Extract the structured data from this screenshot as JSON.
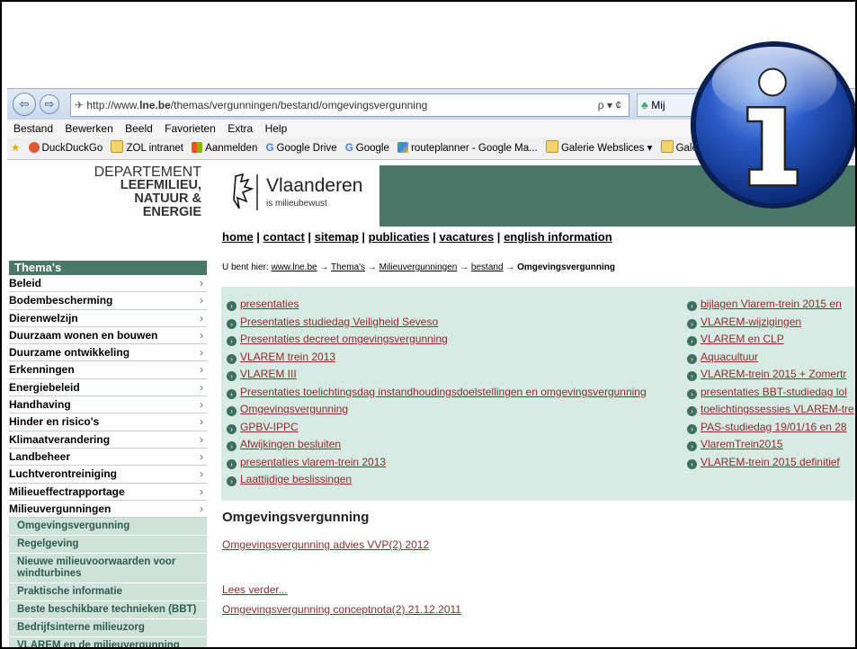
{
  "browser": {
    "url_prefix": "http://www.",
    "url_bold": "lne.be",
    "url_rest": "/themas/vergunningen/bestand/omgevingsvergunning",
    "search_glyph": "ρ ▾ ¢",
    "tab_label": "Mij"
  },
  "menu": [
    "Bestand",
    "Bewerken",
    "Beeld",
    "Favorieten",
    "Extra",
    "Help"
  ],
  "favorites": [
    "DuckDuckGo",
    "ZOL intranet",
    "Aanmelden",
    "Google Drive",
    "Google",
    "routeplanner - Google Ma...",
    "Galerie Webslices ▾",
    "Galerie We"
  ],
  "header": {
    "dept_line1": "DEPARTEMENT",
    "dept_line2": "LEEFMILIEU,",
    "dept_line3": "NATUUR &",
    "dept_line4": "ENERGIE",
    "brand": "Vlaanderen",
    "brand_sub": "is milieubewust"
  },
  "toplinks": [
    "home",
    "contact",
    "sitemap",
    "publicaties",
    "vacatures",
    "english information"
  ],
  "breadcrumb": {
    "prefix": "U bent hier: ",
    "items": [
      "www.lne.be",
      "Thema's",
      "Milieuvergunningen",
      "bestand"
    ],
    "current": "Omgevingsvergunning"
  },
  "sidebar": {
    "title": "Thema's",
    "items": [
      "Beleid",
      "Bodembescherming",
      "Dierenwelzijn",
      "Duurzaam wonen en bouwen",
      "Duurzame ontwikkeling",
      "Erkenningen",
      "Energiebeleid",
      "Handhaving",
      "Hinder en risico's",
      "Klimaatverandering",
      "Landbeheer",
      "Luchtverontreiniging",
      "Milieueffectrapportage",
      "Milieuvergunningen"
    ],
    "subitems": [
      "Omgevingsvergunning",
      "Regelgeving",
      "Nieuwe milieuvoorwaarden voor windturbines",
      "Praktische informatie",
      "Beste beschikbare technieken (BBT)",
      "Bedrijfsinterne milieuzorg",
      "VLAREM en de milieuvergunning"
    ]
  },
  "links_left": [
    "presentaties",
    "Presentaties  studiedag  Veiligheid  Seveso",
    "Presentaties  decreet  omgevingsvergunning",
    "VLAREM  trein  2013",
    "VLAREM  III",
    "Presentaties  toelichtingsdag  instandhoudingsdoelstellingen  en  omgevingsvergunning",
    "Omgevingsvergunning",
    "GPBV-IPPC",
    "Afwijkingen  besluiten",
    "presentaties  vlarem-trein  2013",
    "Laattijdige  beslissingen"
  ],
  "links_right": [
    "bijlagen Vlarem-trein 2015 en",
    "VLAREM-wijzigingen",
    "VLAREM en CLP",
    "Aquacultuur",
    "VLAREM-trein 2015 + Zomertr",
    "presentaties BBT-studiedag lol",
    "toelichtingssessies VLAREM-tre",
    "PAS-studiedag 19/01/16 en 28",
    "VlaremTrein2015",
    "VLAREM-trein 2015  definitief"
  ],
  "content": {
    "heading": "Omgevingsvergunning",
    "link1": "Omgevingsvergunning  advies  VVP(2)  2012",
    "more": "Lees verder...",
    "link2": "Omgevingsvergunning  conceptnota(2).21.12.2011"
  },
  "info_icon_letter": "i"
}
